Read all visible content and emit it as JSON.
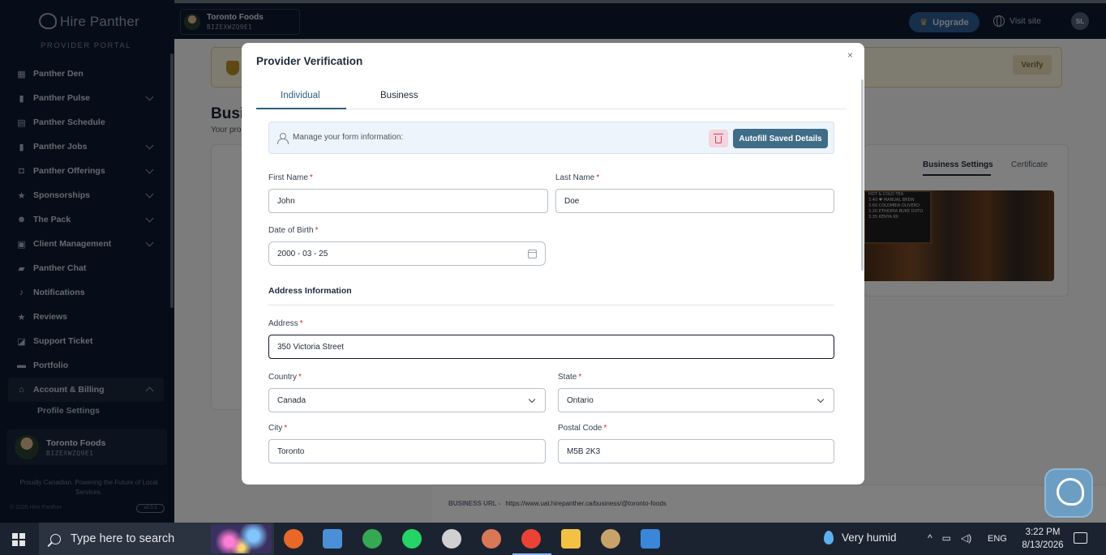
{
  "sidebar": {
    "logo_text": "Hire Panther",
    "portal_label": "PROVIDER PORTAL",
    "items": [
      {
        "label": "Panther Den",
        "icon": "grid-icon",
        "glyph": "▦",
        "chevron": false
      },
      {
        "label": "Panther Pulse",
        "icon": "bar-chart-icon",
        "glyph": "▮",
        "chevron": true
      },
      {
        "label": "Panther Schedule",
        "icon": "calendar-icon",
        "glyph": "▤",
        "chevron": false
      },
      {
        "label": "Panther Jobs",
        "icon": "bookmark-icon",
        "glyph": "▮",
        "chevron": true
      },
      {
        "label": "Panther Offerings",
        "icon": "bag-icon",
        "glyph": "◘",
        "chevron": true
      },
      {
        "label": "Sponsorships",
        "icon": "star-icon",
        "glyph": "★",
        "chevron": true
      },
      {
        "label": "The Pack",
        "icon": "users-icon",
        "glyph": "☻",
        "chevron": true
      },
      {
        "label": "Client Management",
        "icon": "clipboard-icon",
        "glyph": "▣",
        "chevron": true
      },
      {
        "label": "Panther Chat",
        "icon": "chat-icon",
        "glyph": "▰",
        "chevron": false
      },
      {
        "label": "Notifications",
        "icon": "bell-icon",
        "glyph": "♪",
        "chevron": false
      },
      {
        "label": "Reviews",
        "icon": "star-icon",
        "glyph": "★",
        "chevron": false
      },
      {
        "label": "Support Ticket",
        "icon": "ticket-icon",
        "glyph": "◪",
        "chevron": false
      },
      {
        "label": "Portfolio",
        "icon": "briefcase-icon",
        "glyph": "▬",
        "chevron": false
      },
      {
        "label": "Account & Billing",
        "icon": "bank-icon",
        "glyph": "⌂",
        "chevron": true,
        "active": true
      }
    ],
    "sub_item": "Profile Settings",
    "account": {
      "name": "Toronto Foods",
      "code": "BIZEXWZQ9E1"
    },
    "tagline": "Proudly Canadian. Powering the Future of Local Services.",
    "copyright": "© 2026 Hire Panther",
    "toggle_label": "v2.0.1"
  },
  "topbar": {
    "business": {
      "name": "Toronto Foods",
      "code": "BIZEXWZQ9E1"
    },
    "upgrade_label": "Upgrade",
    "visit_site_label": "Visit site",
    "user_initials": "SL"
  },
  "background": {
    "verify_label": "Verify",
    "heading": "Busi",
    "subheading": "Your pro",
    "tab_business_settings": "Business Settings",
    "tab_certificate": "Certificate",
    "board_lines": [
      "HOT & COLD TEA",
      "3.40  ♥ MANUAL BREW",
      "3.60  COLOMBIA OLIVERO",
      "3.20  ETHIOPIA BUKE DUTO",
      "3.35  KENYA KII"
    ],
    "url_label": "BUSINESS URL -",
    "url_value": "https://www.uat.hirepanther.ca/business/@toronto-foods"
  },
  "modal": {
    "title": "Provider Verification",
    "close_glyph": "×",
    "tabs": [
      {
        "label": "Individual",
        "active": true
      },
      {
        "label": "Business",
        "active": false
      }
    ],
    "manage_text": "Manage your form information:",
    "autofill_label": "Autofill Saved Details",
    "fields": {
      "first_name": {
        "label": "First Name",
        "value": "John"
      },
      "last_name": {
        "label": "Last Name",
        "value": "Doe"
      },
      "dob": {
        "label": "Date of Birth",
        "value": "2000 - 03 - 25"
      },
      "address": {
        "label": "Address",
        "value": "350 Victoria Street"
      },
      "country": {
        "label": "Country",
        "value": "Canada"
      },
      "state": {
        "label": "State",
        "value": "Ontario"
      },
      "city": {
        "label": "City",
        "value": "Toronto"
      },
      "postal_code": {
        "label": "Postal Code",
        "value": "M5B 2K3"
      }
    },
    "required_mark": "*",
    "section_address": "Address Information"
  },
  "taskbar": {
    "search_placeholder": "Type here to search",
    "weather": "Very humid",
    "language": "ENG",
    "time": "3:22 PM",
    "date": "8/13/2026",
    "apps": [
      {
        "name": "firefox",
        "color": "#e8682a"
      },
      {
        "name": "file-transfer",
        "color": "#4a90d9"
      },
      {
        "name": "chrome",
        "color": "#34a853"
      },
      {
        "name": "whatsapp",
        "color": "#25d366"
      },
      {
        "name": "chatgpt",
        "color": "#d0d0d0"
      },
      {
        "name": "claude",
        "color": "#d97757"
      },
      {
        "name": "chrome-active",
        "color": "#ea4335"
      },
      {
        "name": "file-explorer",
        "color": "#f3c244"
      },
      {
        "name": "paint",
        "color": "#c9a26b"
      },
      {
        "name": "photos",
        "color": "#3a86d8"
      }
    ]
  }
}
